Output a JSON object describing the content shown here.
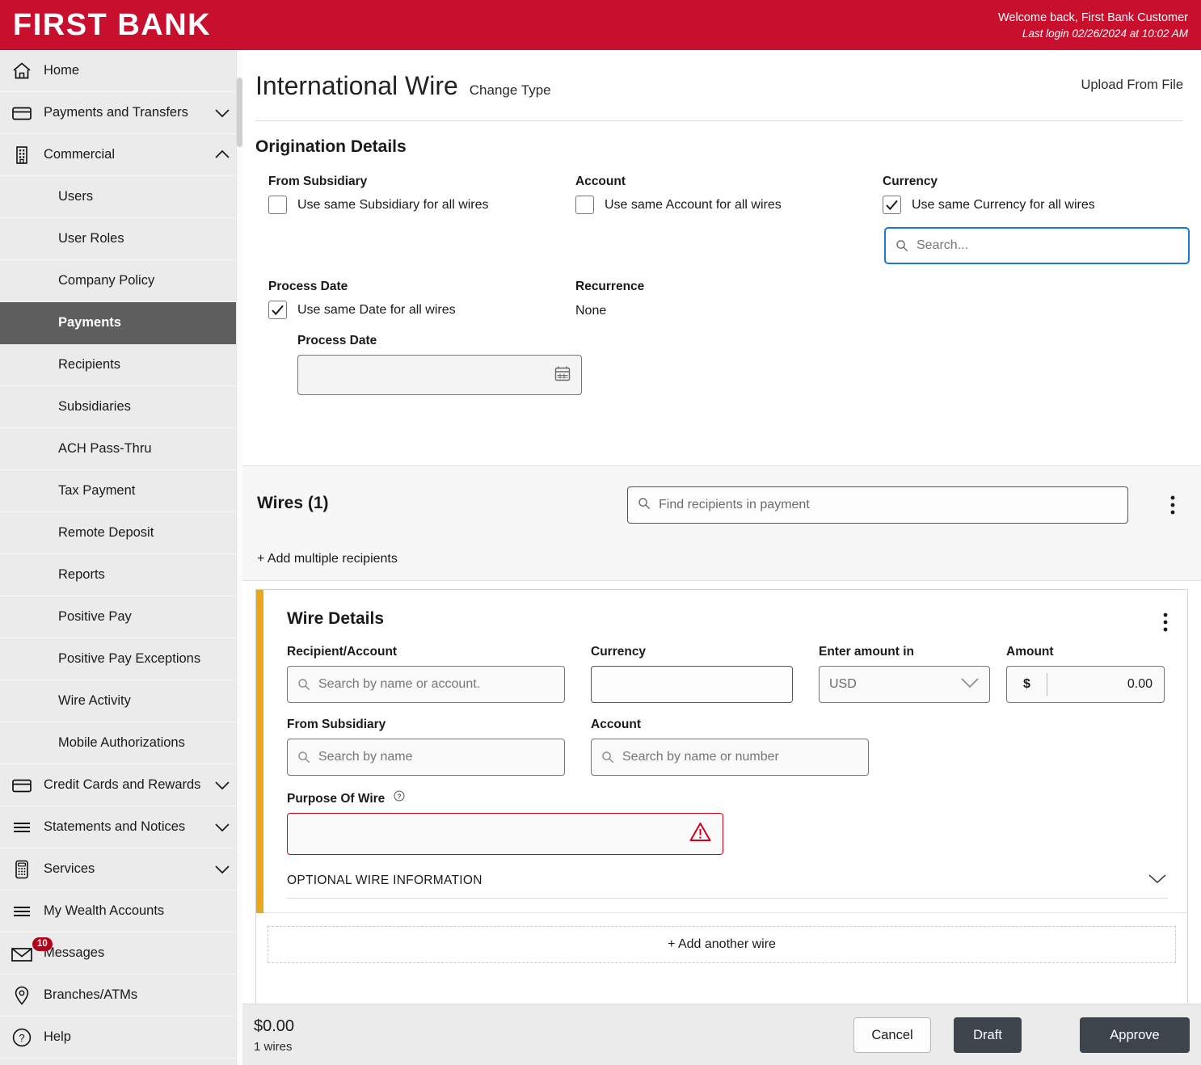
{
  "brand": {
    "name": "FIRST BANK",
    "color": "#c8102e"
  },
  "header": {
    "welcome": "Welcome back, First Bank Customer",
    "last_login": "Last login 02/26/2024 at 10:02 AM"
  },
  "sidebar": {
    "items": [
      {
        "label": "Home",
        "icon": "home-icon",
        "level": "top",
        "chevron": "",
        "active": false
      },
      {
        "label": "Payments and Transfers",
        "icon": "card-icon",
        "level": "top",
        "chevron": "down",
        "active": false
      },
      {
        "label": "Commercial",
        "icon": "building-icon",
        "level": "top",
        "chevron": "up",
        "active": false
      },
      {
        "label": "Users",
        "icon": "",
        "level": "sub",
        "chevron": "",
        "active": false
      },
      {
        "label": "User Roles",
        "icon": "",
        "level": "sub",
        "chevron": "",
        "active": false
      },
      {
        "label": "Company Policy",
        "icon": "",
        "level": "sub",
        "chevron": "",
        "active": false
      },
      {
        "label": "Payments",
        "icon": "",
        "level": "sub",
        "chevron": "",
        "active": true
      },
      {
        "label": "Recipients",
        "icon": "",
        "level": "sub",
        "chevron": "",
        "active": false
      },
      {
        "label": "Subsidiaries",
        "icon": "",
        "level": "sub",
        "chevron": "",
        "active": false
      },
      {
        "label": "ACH Pass-Thru",
        "icon": "",
        "level": "sub",
        "chevron": "",
        "active": false
      },
      {
        "label": "Tax Payment",
        "icon": "",
        "level": "sub",
        "chevron": "",
        "active": false
      },
      {
        "label": "Remote Deposit",
        "icon": "",
        "level": "sub",
        "chevron": "",
        "active": false
      },
      {
        "label": "Reports",
        "icon": "",
        "level": "sub",
        "chevron": "",
        "active": false
      },
      {
        "label": "Positive Pay",
        "icon": "",
        "level": "sub",
        "chevron": "",
        "active": false
      },
      {
        "label": "Positive Pay Exceptions",
        "icon": "",
        "level": "sub",
        "chevron": "",
        "active": false
      },
      {
        "label": "Wire Activity",
        "icon": "",
        "level": "sub",
        "chevron": "",
        "active": false
      },
      {
        "label": "Mobile Authorizations",
        "icon": "",
        "level": "sub",
        "chevron": "",
        "active": false
      },
      {
        "label": "Credit Cards and Rewards",
        "icon": "card-icon",
        "level": "top",
        "chevron": "down",
        "active": false
      },
      {
        "label": "Statements and Notices",
        "icon": "lines-icon",
        "level": "top",
        "chevron": "down",
        "active": false
      },
      {
        "label": "Services",
        "icon": "calculator-icon",
        "level": "top",
        "chevron": "down",
        "active": false
      },
      {
        "label": "My Wealth Accounts",
        "icon": "lines-icon",
        "level": "top",
        "chevron": "",
        "active": false
      },
      {
        "label": "Messages",
        "icon": "envelope-icon",
        "level": "top",
        "chevron": "",
        "active": false,
        "badge": "10"
      },
      {
        "label": "Branches/ATMs",
        "icon": "pin-icon",
        "level": "top",
        "chevron": "",
        "active": false
      },
      {
        "label": "Help",
        "icon": "question-icon",
        "level": "top",
        "chevron": "",
        "active": false
      }
    ]
  },
  "page": {
    "title": "International Wire",
    "change_type": "Change Type",
    "upload_from_file": "Upload From File"
  },
  "origination": {
    "section_title": "Origination Details",
    "from_subsidiary": {
      "label": "From Subsidiary",
      "checkbox_label": "Use same Subsidiary for all wires",
      "checked": false
    },
    "account": {
      "label": "Account",
      "checkbox_label": "Use same Account for all wires",
      "checked": false
    },
    "currency": {
      "label": "Currency",
      "checkbox_label": "Use same Currency for all wires",
      "checked": true,
      "search_placeholder": "Search...",
      "search_value": "",
      "focused": true,
      "focus_color": "#1878e0"
    },
    "process_date": {
      "label": "Process Date",
      "checkbox_label": "Use same Date for all wires",
      "checked": true,
      "field_label": "Process Date",
      "value": ""
    },
    "recurrence": {
      "label": "Recurrence",
      "value": "None"
    }
  },
  "wires_bar": {
    "count_label": "Wires (1)",
    "find_placeholder": "Find recipients in payment",
    "add_multiple": "+ Add multiple recipients"
  },
  "wire_card": {
    "title": "Wire Details",
    "accent_color": "#eaa71a",
    "recipient": {
      "label": "Recipient/Account",
      "placeholder": "Search by name or account.",
      "value": ""
    },
    "currency": {
      "label": "Currency",
      "value": ""
    },
    "enter_amount_in": {
      "label": "Enter amount in",
      "value": "USD"
    },
    "amount": {
      "label": "Amount",
      "symbol": "$",
      "value": "0.00"
    },
    "from_subsidiary": {
      "label": "From Subsidiary",
      "placeholder": "Search by name",
      "value": ""
    },
    "account": {
      "label": "Account",
      "placeholder": "Search by name or number",
      "value": ""
    },
    "purpose_of_wire": {
      "label": "Purpose Of Wire",
      "value": "",
      "has_error": true,
      "error_color": "#d0021b"
    },
    "optional_section": "OPTIONAL WIRE INFORMATION",
    "add_another_wire": "+ Add another wire"
  },
  "footer": {
    "total": "$0.00",
    "wire_count": "1 wires",
    "cancel": "Cancel",
    "draft": "Draft",
    "approve": "Approve"
  }
}
